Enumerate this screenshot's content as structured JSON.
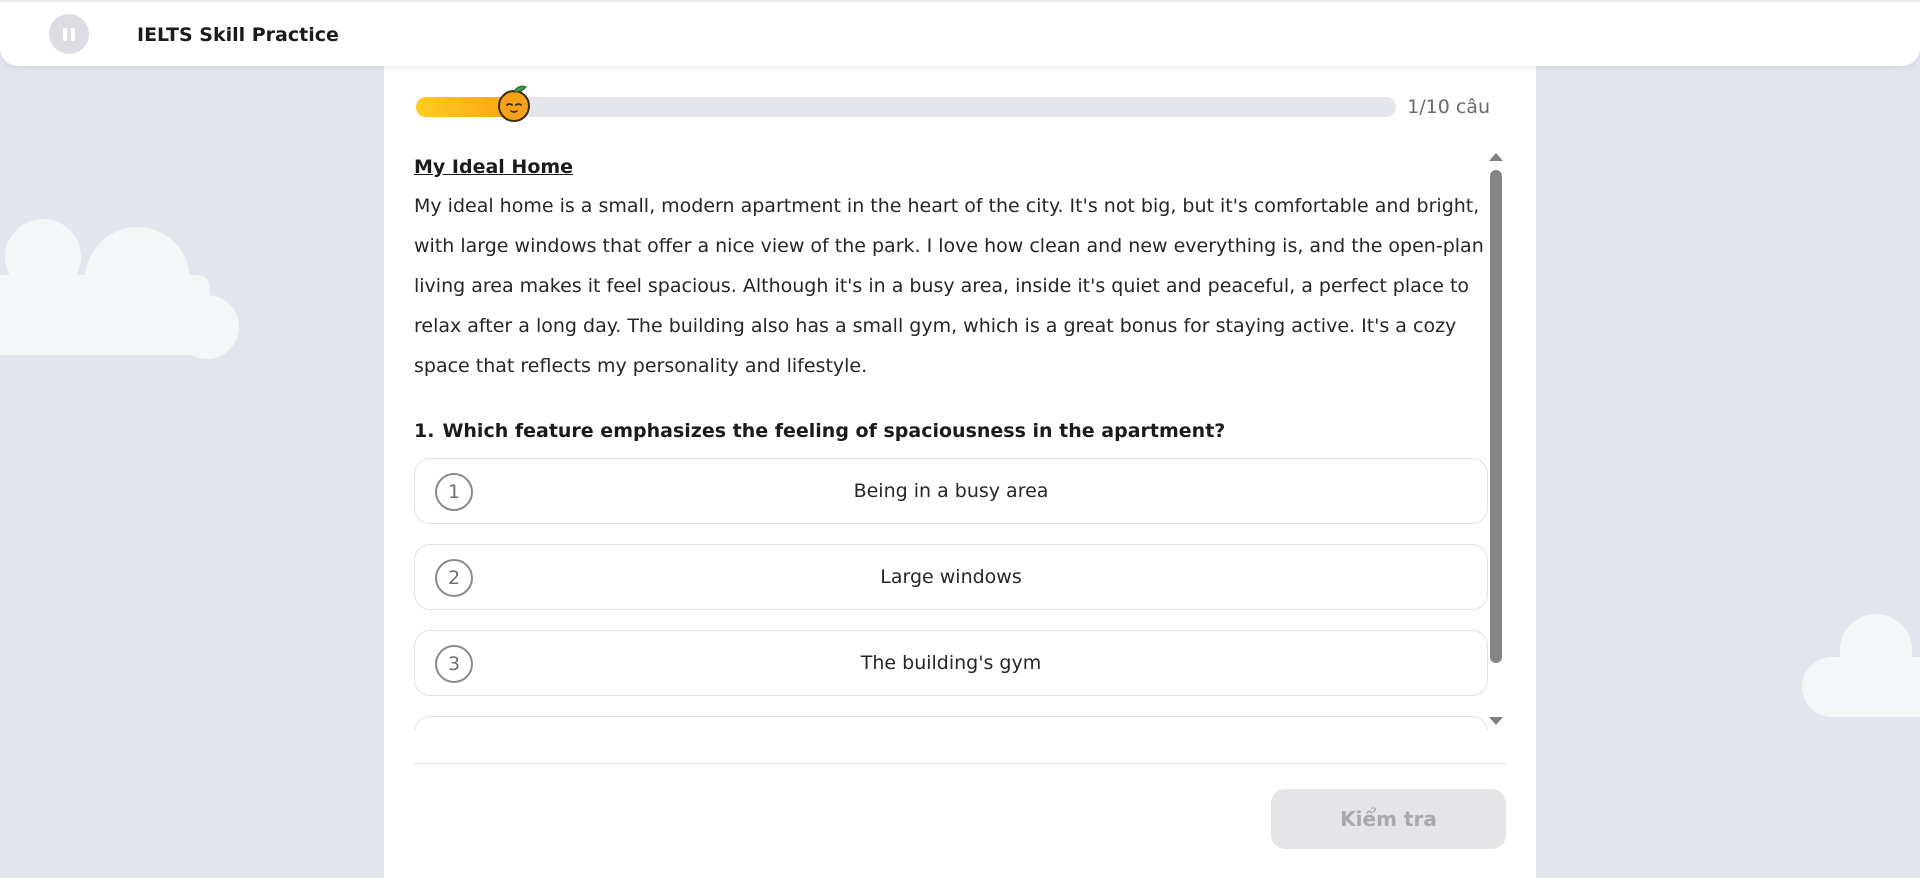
{
  "header": {
    "title": "IELTS Skill Practice",
    "pause_icon": "pause-icon"
  },
  "progress": {
    "current": 1,
    "total": 10,
    "fraction": 0.1,
    "label": "1/10 câu",
    "mascot_icon": "orange-mascot-icon"
  },
  "passage": {
    "title": "My Ideal Home",
    "body": "My ideal home is a small, modern apartment in the heart of the city. It's not big, but it's comfortable and bright, with large windows that offer a nice view of the park. I love how clean and new everything is, and the open-plan living area makes it feel spacious. Although it's in a busy area, inside it's quiet and peaceful, a perfect place to relax after a long day. The building also has a small gym, which is a great bonus for staying active. It's a cozy space that reflects my personality and lifestyle."
  },
  "question": {
    "number": "1.",
    "text": "Which feature emphasizes the feeling of spaciousness in the apartment?"
  },
  "options": [
    {
      "number": "1",
      "label": "Being in a busy area"
    },
    {
      "number": "2",
      "label": "Large windows"
    },
    {
      "number": "3",
      "label": "The building's gym"
    }
  ],
  "footer": {
    "check_label": "Kiểm tra"
  },
  "colors": {
    "background": "#e2e5ec",
    "progress_start": "#ffcc1f",
    "progress_end": "#f7a516",
    "button_disabled_bg": "#e5e5e8",
    "button_disabled_text": "#a9a9ad"
  }
}
